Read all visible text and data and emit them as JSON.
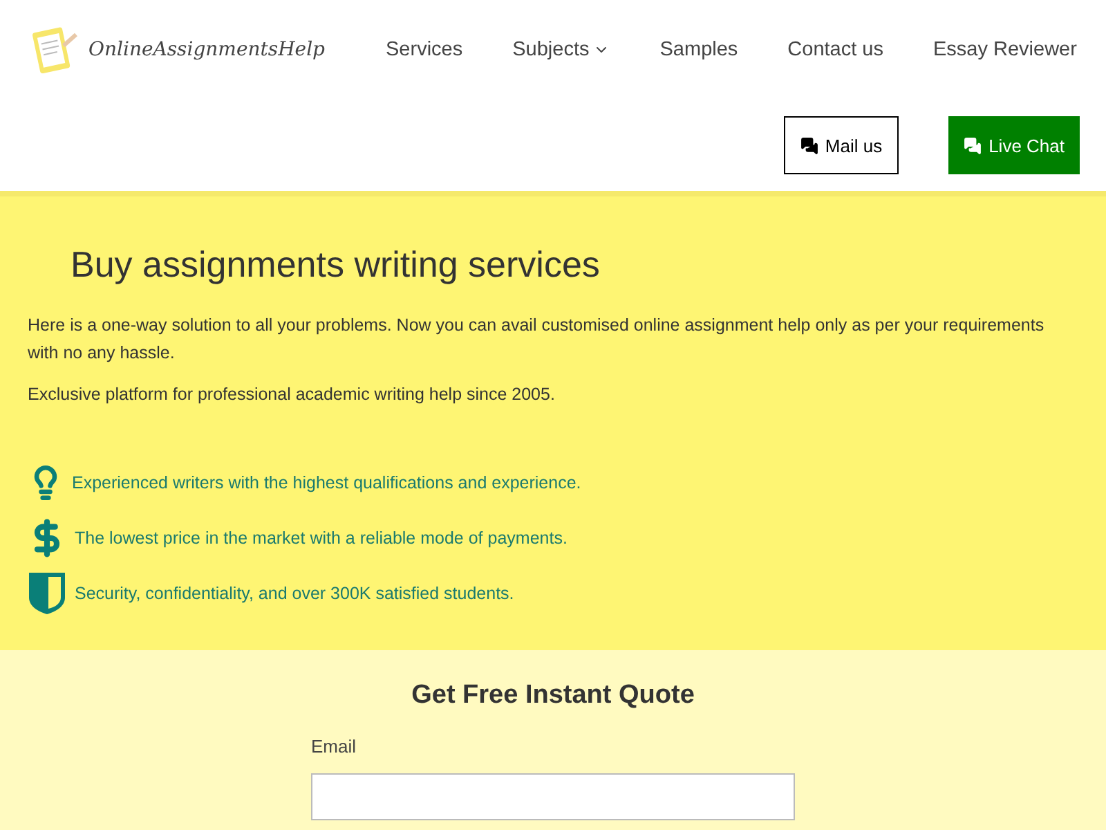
{
  "logo": {
    "text": "OnlineAssignmentsHelp"
  },
  "nav": [
    {
      "label": "Services",
      "dropdown": false
    },
    {
      "label": "Subjects",
      "dropdown": true
    },
    {
      "label": "Samples",
      "dropdown": false
    },
    {
      "label": "Contact us",
      "dropdown": false
    },
    {
      "label": "Essay Reviewer",
      "dropdown": false
    }
  ],
  "actions": [
    {
      "label": "Mail us",
      "kind": "outline"
    },
    {
      "label": "Live Chat",
      "kind": "filled"
    }
  ],
  "hero": {
    "title": "Buy assignments writing services",
    "paragraphs": [
      "Here is a one-way solution to all your problems. Now you can avail customised online assignment help only as per your requirements with no any hassle.",
      "Exclusive platform for professional academic writing help since 2005."
    ],
    "features": [
      {
        "kind": "bulb",
        "text": "Experienced writers with the highest qualifications and experience."
      },
      {
        "kind": "dollar",
        "text": "The lowest price in the market with a reliable mode of payments."
      },
      {
        "kind": "shield",
        "text": "Security, confidentiality, and over 300K satisfied students."
      }
    ]
  },
  "quote": {
    "title": "Get Free Instant Quote",
    "fields": [
      {
        "label": "Email"
      }
    ]
  }
}
